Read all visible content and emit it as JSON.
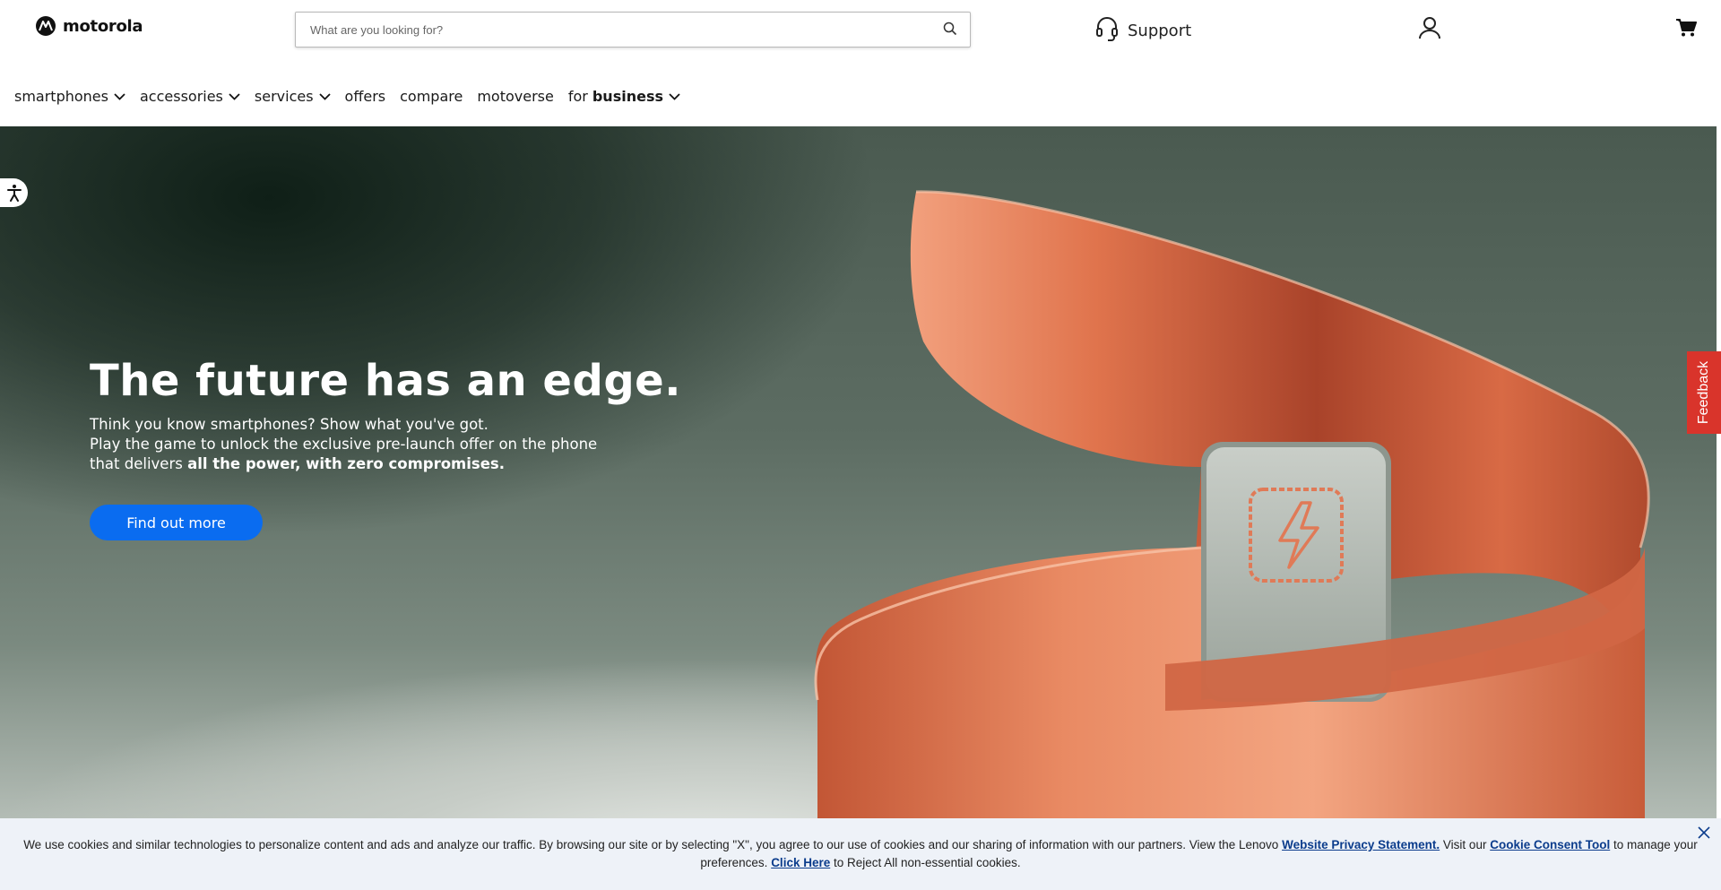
{
  "header": {
    "logo_text": "motorola",
    "search": {
      "placeholder": "What are you looking for?"
    },
    "support_label": "Support"
  },
  "nav": {
    "smartphones": "smartphones",
    "accessories": "accessories",
    "services": "services",
    "offers": "offers",
    "compare": "compare",
    "motoverse": "motoverse",
    "for_prefix": "for",
    "business": "business"
  },
  "hero": {
    "title": "The future has an edge.",
    "line1": "Think you know smartphones? Show what you've got.",
    "line2": "Play the game to unlock the exclusive pre-launch offer on the phone",
    "line3_prefix": "that delivers",
    "line3_bold": "all the power, with zero compromises.",
    "cta_label": "Find out more"
  },
  "feedback_label": "Feedback",
  "cookie": {
    "text_1": "We use cookies and similar technologies to personalize content and ads and analyze our traffic. By browsing our site or by selecting \"X\", you agree to our use of cookies and our sharing of information with our partners. View the Lenovo",
    "privacy_link": "Website Privacy Statement.",
    "text_2": "Visit our",
    "consent_link": "Cookie Consent Tool",
    "text_3": "to manage your preferences.",
    "reject_link": "Click Here",
    "text_4": "to Reject All non-essential cookies."
  },
  "colors": {
    "cta_blue": "#0a6cf0",
    "feedback_red": "#d9342b",
    "copper": "#d96a45",
    "cookie_bg": "#eef2f8"
  },
  "icons": [
    "motorola-logo-icon",
    "search-icon",
    "headset-icon",
    "user-icon",
    "cart-icon",
    "chevron-down-icon",
    "accessibility-icon",
    "close-icon"
  ]
}
